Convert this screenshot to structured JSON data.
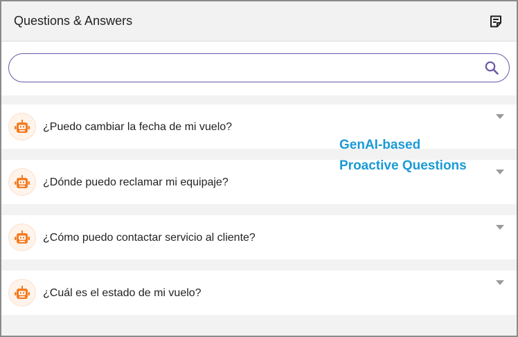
{
  "header": {
    "title": "Questions & Answers",
    "notes_icon": "notes-icon"
  },
  "search": {
    "value": "",
    "placeholder": "",
    "icon": "search-icon"
  },
  "questions": [
    {
      "text": "¿Puedo cambiar la fecha de mi vuelo?",
      "icon": "bot-icon"
    },
    {
      "text": "¿Dónde puedo reclamar mi equipaje?",
      "icon": "bot-icon"
    },
    {
      "text": "¿Cómo puedo contactar servicio al cliente?",
      "icon": "bot-icon"
    },
    {
      "text": "¿Cuál es el estado de mi vuelo?",
      "icon": "bot-icon"
    }
  ],
  "annotation": {
    "line1": "GenAI-based",
    "line2": "Proactive Questions"
  },
  "colors": {
    "accent": "#6b56a8",
    "bot_icon": "#f47b20",
    "annotation": "#1a9ad6"
  }
}
